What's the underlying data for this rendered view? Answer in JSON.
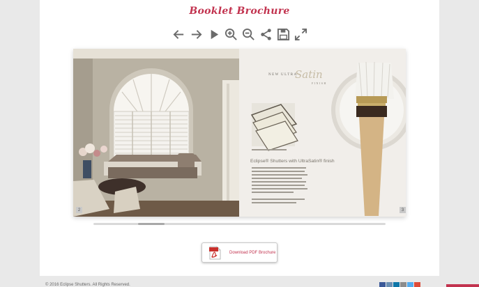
{
  "header": {
    "title": "Booklet Brochure"
  },
  "toolbar": {
    "items": [
      "arrow-left-icon",
      "arrow-right-icon",
      "play-icon",
      "zoom-in-icon",
      "zoom-out-icon",
      "share-icon",
      "save-icon",
      "fullscreen-icon"
    ]
  },
  "book": {
    "left_page_number": "2",
    "right_page_number": "3",
    "right_page": {
      "heading_new": "NEW",
      "heading_ultra": "ULTRA",
      "heading_satin": "Satin",
      "heading_finish": "FINISH",
      "product_title": "Eclipse® Shutters with UltraSatin® finish"
    }
  },
  "download": {
    "label": "Download PDF Brochure"
  },
  "footer": {
    "copyright": "© 2016 Eclipse Shutters. All Rights Reserved."
  },
  "colors": {
    "accent": "#c2334f",
    "background": "#e9e9e9"
  }
}
